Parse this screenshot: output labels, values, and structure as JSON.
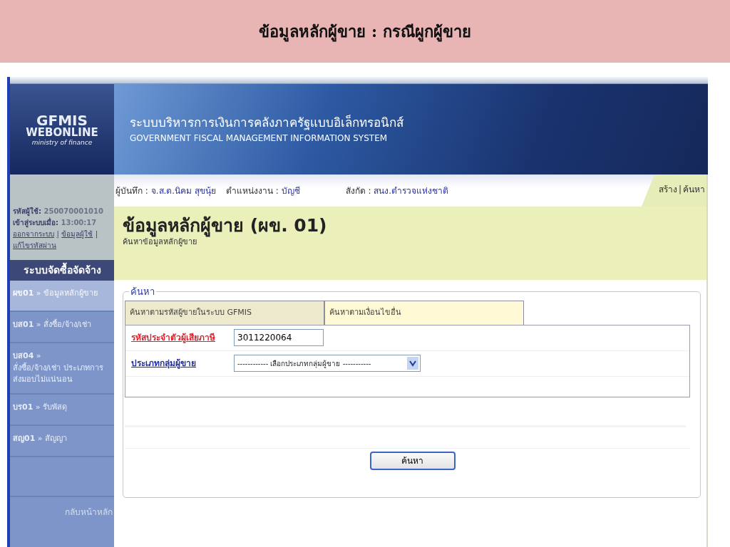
{
  "slide_title": "ข้อมูลหลักผู้ขาย : กรณีผูกผู้ขาย",
  "logo": {
    "line1": "GFMIS",
    "line2": "WEBONLINE",
    "line3": "ministry of finance"
  },
  "banner": {
    "title_th": "ระบบบริหารการเงินการคลังภาครัฐแบบอิเล็กทรอนิกส์",
    "title_en": "GOVERNMENT FISCAL MANAGEMENT INFORMATION SYSTEM"
  },
  "user_panel": {
    "user_id_label": "รหัสผู้ใช้:",
    "user_id": "250070001010",
    "login_label": "เข้าสู่ระบบเมื่อ:",
    "login_time": "13:00:17",
    "separator": "|",
    "links": [
      "ออกจากระบบ",
      "ข้อมูลผู้ใช้",
      "แก้ไขรหัสผ่าน"
    ]
  },
  "menu": {
    "title": "ระบบจัดซื้อจัดจ้าง",
    "arrow": "»",
    "items": [
      {
        "code": "ผข01",
        "label": "ข้อมูลหลักผู้ขาย",
        "selected": true
      },
      {
        "code": "บส01",
        "label": "สั่งซื้อ/จ้าง/เช่า",
        "selected": false
      },
      {
        "code": "บส04",
        "label": "สั่งซื้อ/จ้าง/เช่า ประเภทการส่งมอบไม่แน่นอน",
        "selected": false
      },
      {
        "code": "บร01",
        "label": "รับพัสดุ",
        "selected": false
      },
      {
        "code": "สญ01",
        "label": "สัญญา",
        "selected": false
      }
    ],
    "back_link": "กลับหน้าหลัก"
  },
  "info_bar": {
    "recorder_label": "ผู้บันทึก :",
    "recorder": "จ.ส.ต.นิคม สุขนุ้ย",
    "position_label": "ตำแหน่งงาน :",
    "position": "บัญชี",
    "affiliation_label": "สังกัด :",
    "affiliation": "สนง.ตำรวจแห่งชาติ",
    "separator": "|",
    "actions": [
      "สร้าง",
      "ค้นหา"
    ]
  },
  "page": {
    "title": "ข้อมูลหลักผู้ขาย (ผข. 01)",
    "subtitle": "ค้นหาข้อมูลหลักผู้ขาย"
  },
  "search": {
    "legend": "ค้นหา",
    "tabs": [
      {
        "label": "ค้นหาตามรหัสผู้ขายในระบบ GFMIS",
        "selected": true
      },
      {
        "label": "ค้นหาตามเงื่อนไขอื่น",
        "selected": false
      }
    ],
    "fields": [
      {
        "kind": "text",
        "label": "รหัสประจำตัวผู้เสียภาษี",
        "required": true,
        "value": "3011220064"
      },
      {
        "kind": "select",
        "label": "ประเภทกลุ่มผู้ขาย",
        "required": false,
        "value": "------------ เลือกประเภทกลุ่มผู้ขาย -----------"
      }
    ],
    "button": "ค้นหา"
  }
}
